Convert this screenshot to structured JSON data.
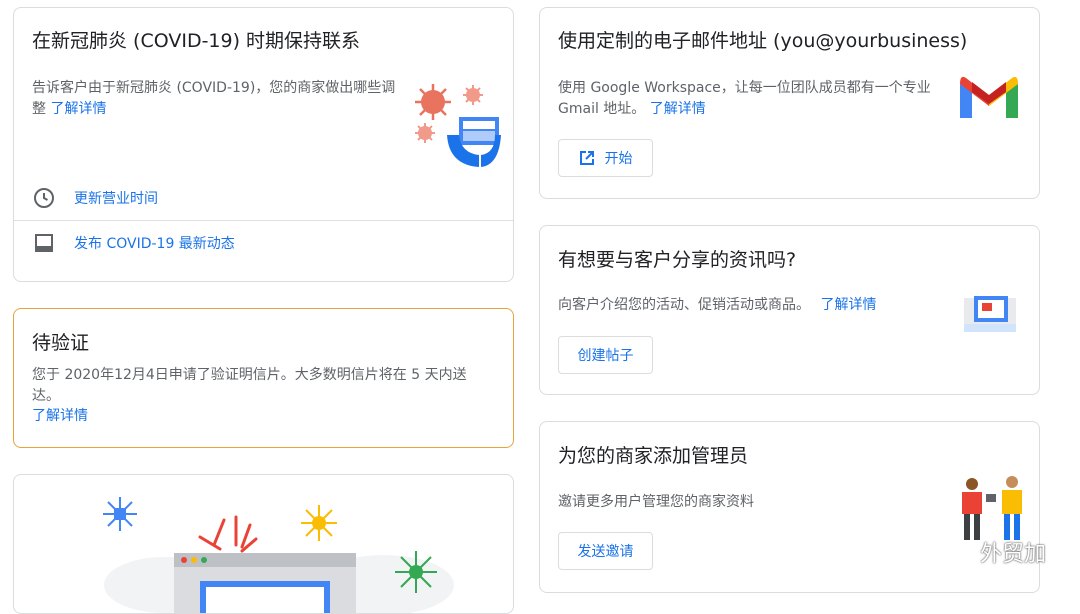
{
  "covid_card": {
    "title": "在新冠肺炎 (COVID-19) 时期保持联系",
    "desc": "告诉客户由于新冠肺炎 (COVID-19)，您的商家做出哪些调整",
    "learn_more": "了解详情",
    "rows": [
      {
        "label": "更新营业时间",
        "icon": "clock-icon"
      },
      {
        "label": "发布 COVID-19 最新动态",
        "icon": "post-icon"
      }
    ]
  },
  "pending_card": {
    "title": "待验证",
    "desc": "您于 2020年12月4日申请了验证明信片。大多数明信片将在 5 天内送达。",
    "learn_more": "了解详情"
  },
  "email_card": {
    "title": "使用定制的电子邮件地址 (you@yourbusiness)",
    "desc": "使用 Google Workspace，让每一位团队成员都有一个专业 Gmail 地址。",
    "learn_more": "了解详情",
    "button": "开始"
  },
  "share_card": {
    "title": "有想要与客户分享的资讯吗?",
    "desc": "向客户介绍您的活动、促销活动或商品。",
    "learn_more": "了解详情",
    "button": "创建帖子"
  },
  "admin_card": {
    "title": "为您的商家添加管理员",
    "desc": "邀请更多用户管理您的商家资料",
    "button": "发送邀请"
  },
  "watermark": {
    "text": "外贸加"
  },
  "colors": {
    "accent": "#1a73e8",
    "pending_border": "#e8a33d",
    "virus": "#e8735e"
  }
}
